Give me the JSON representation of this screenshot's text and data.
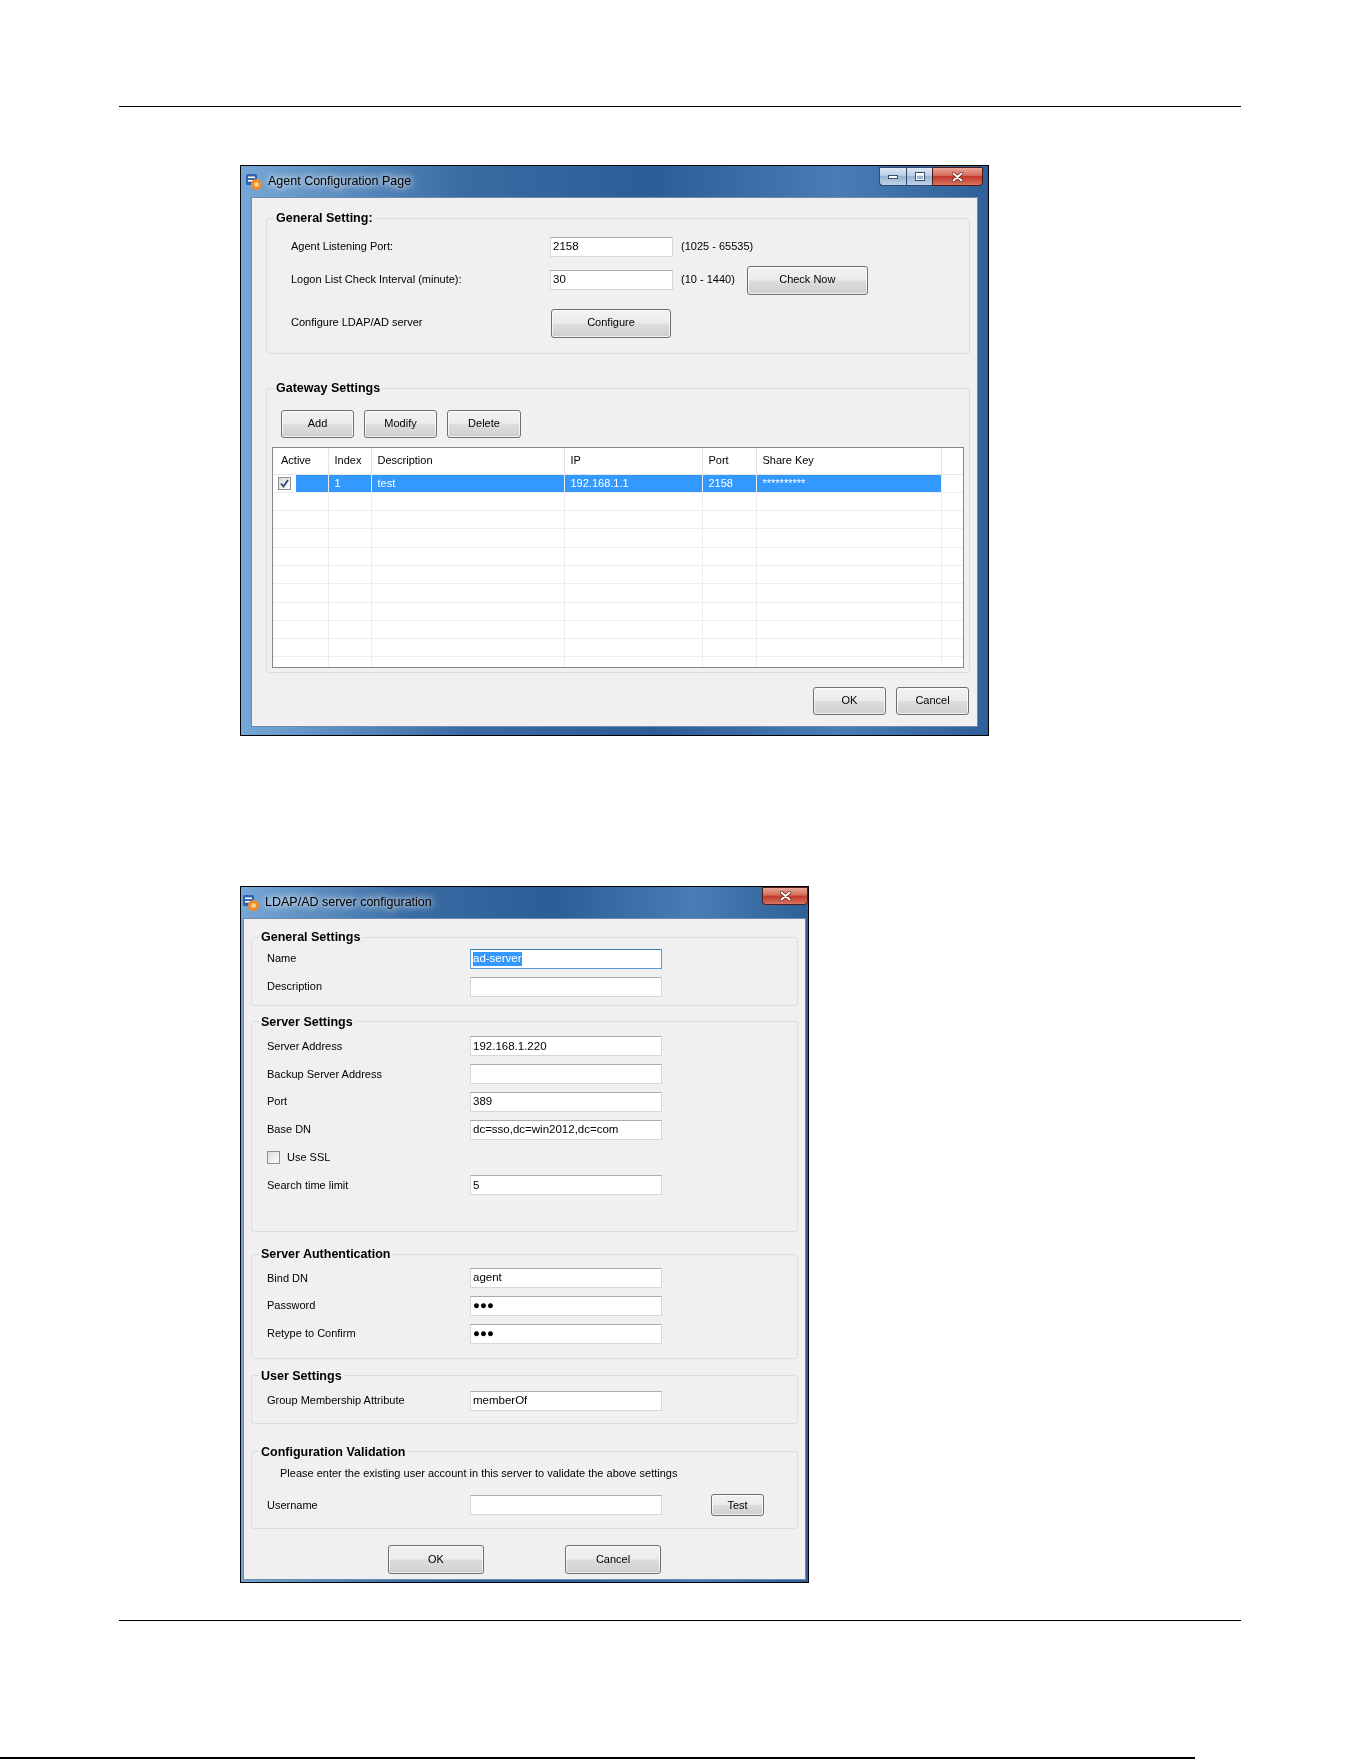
{
  "agent_window": {
    "title": "Agent Configuration Page",
    "general_setting": {
      "title": "General Setting:",
      "rows": [
        {
          "kind": "field",
          "label": "Agent Listening Port:",
          "value": "2158",
          "range": "(1025 - 65535)"
        },
        {
          "kind": "field",
          "label": "Logon List Check Interval (minute):",
          "value": "30",
          "range": "(10 - 1440)",
          "button": "Check Now"
        },
        {
          "kind": "button",
          "label": "Configure LDAP/AD server",
          "button": "Configure"
        }
      ]
    },
    "gateway_settings": {
      "title": "Gateway Settings",
      "buttons": [
        "Add",
        "Modify",
        "Delete"
      ],
      "table": {
        "columns": [
          "Active",
          "Index",
          "Description",
          "IP",
          "Port",
          "Share Key"
        ],
        "rows": [
          {
            "active": true,
            "selected": true,
            "cells": [
              "",
              "1",
              "test",
              "192.168.1.1",
              "2158",
              "**********"
            ]
          }
        ]
      }
    },
    "buttons": [
      "OK",
      "Cancel"
    ]
  },
  "ldap_window": {
    "title": "LDAP/AD server configuration",
    "groups": [
      {
        "title": "General Settings",
        "rows": [
          {
            "kind": "field",
            "label": "Name",
            "value": "ad-server",
            "focused": true
          },
          {
            "kind": "field",
            "label": "Description",
            "focused": false
          }
        ]
      },
      {
        "title": "Server Settings",
        "rows": [
          {
            "kind": "field",
            "label": "Server Address",
            "value": "192.168.1.220",
            "focused": false
          },
          {
            "kind": "field",
            "label": "Backup Server Address",
            "focused": false
          },
          {
            "kind": "field",
            "label": "Port",
            "value": "389",
            "focused": false
          },
          {
            "kind": "field",
            "label": "Base DN",
            "value": "dc=sso,dc=win2012,dc=com",
            "focused": false
          },
          {
            "kind": "checkbox",
            "label": "Use SSL",
            "checked": false
          },
          {
            "kind": "field",
            "label": "Search time limit",
            "value": "5",
            "focused": false
          }
        ]
      },
      {
        "title": "Server Authentication",
        "rows": [
          {
            "kind": "field",
            "label": "Bind DN",
            "value": "agent",
            "focused": false
          },
          {
            "kind": "field",
            "label": "Password",
            "value": "●●●",
            "focused": false
          },
          {
            "kind": "field",
            "label": "Retype to Confirm",
            "value": "●●●",
            "focused": false
          }
        ]
      },
      {
        "title": "User Settings",
        "rows": [
          {
            "kind": "field",
            "label": "Group Membership Attribute",
            "value": "memberOf",
            "focused": false
          }
        ]
      },
      {
        "title": "Configuration Validation",
        "rows": [
          {
            "kind": "note",
            "text": "Please enter the existing user account in this server to validate the above settings"
          },
          {
            "kind": "field",
            "label": "Username",
            "focused": false,
            "button": "Test"
          }
        ]
      }
    ],
    "buttons": [
      "OK",
      "Cancel"
    ]
  }
}
